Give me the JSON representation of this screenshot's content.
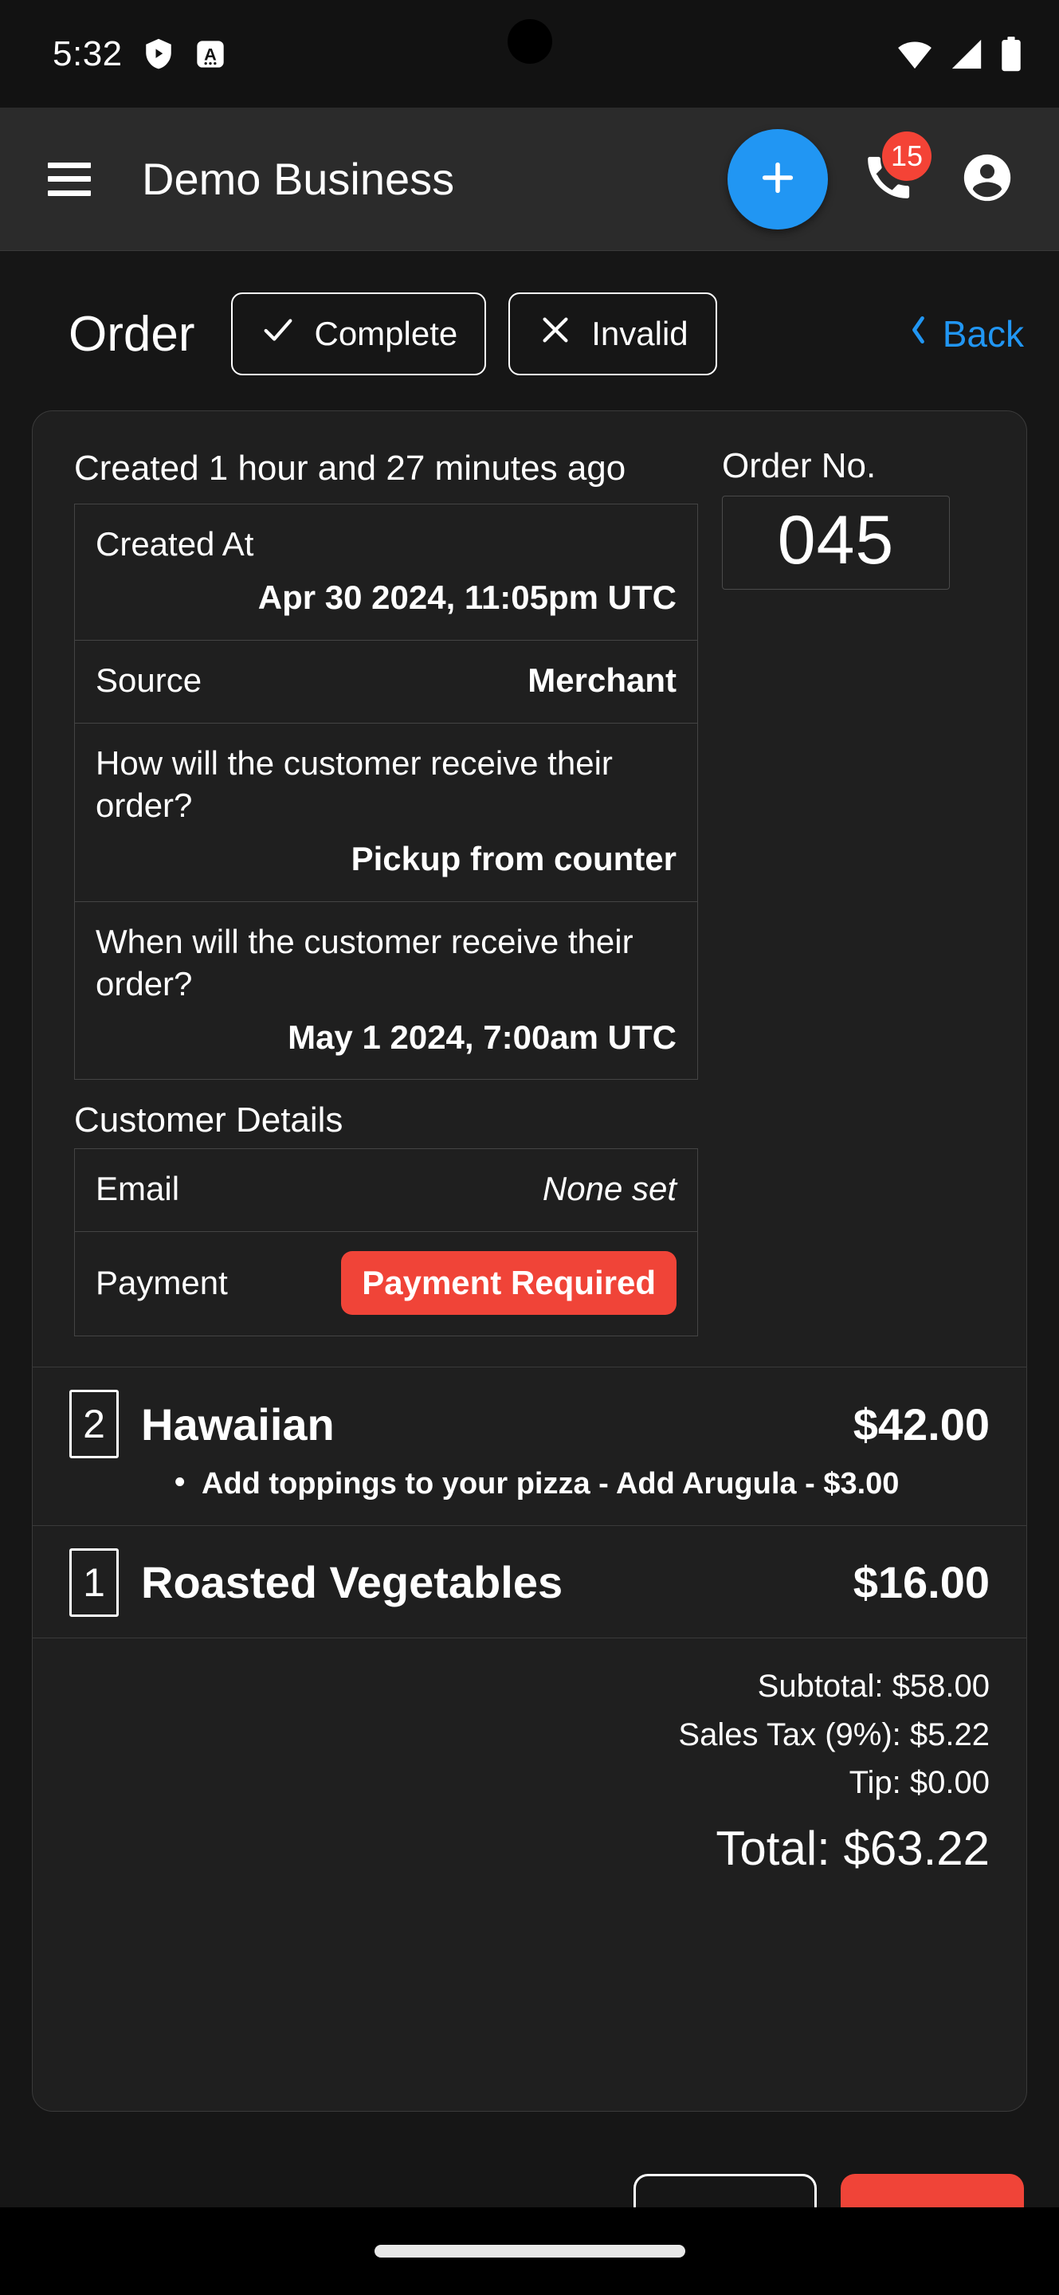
{
  "status_bar": {
    "time": "5:32",
    "left_icons": [
      "shield-play-icon",
      "a-notification-icon"
    ],
    "right_icons": [
      "wifi-icon",
      "cellular-signal-icon",
      "battery-icon"
    ]
  },
  "app_bar": {
    "menu_icon": "hamburger-menu-icon",
    "title": "Demo Business",
    "add_icon": "plus-icon",
    "phone_icon": "phone-icon",
    "call_badge_count": "15",
    "account_icon": "account-circle-icon",
    "accent_color": "#2196F3",
    "badge_color": "#F44336"
  },
  "page_header": {
    "title": "Order",
    "complete_label": "Complete",
    "complete_icon": "check-icon",
    "invalid_label": "Invalid",
    "invalid_icon": "close-x-icon",
    "back_label": "Back",
    "back_icon": "chevron-left-icon",
    "back_color": "#2196F3"
  },
  "order": {
    "created_ago": "Created 1 hour and 27 minutes ago",
    "order_no_label": "Order No.",
    "order_no_value": "045",
    "details": [
      {
        "label": "Created At",
        "value": "Apr 30 2024, 11:05pm UTC",
        "stacked": true
      },
      {
        "label": "Source",
        "value": "Merchant",
        "stacked": false
      },
      {
        "label": "How will the customer receive their order?",
        "value": "Pickup from counter",
        "stacked": true
      },
      {
        "label": "When will the customer receive their order?",
        "value": "May 1 2024, 7:00am UTC",
        "stacked": true
      }
    ],
    "customer_details_label": "Customer Details",
    "customer": [
      {
        "label": "Email",
        "value": "None set"
      }
    ],
    "payment_label": "Payment",
    "payment_status": "Payment Required",
    "payment_status_color": "#F04438"
  },
  "line_items": [
    {
      "qty": "2",
      "name": "Hawaiian",
      "price": "$42.00",
      "modifiers": [
        "Add toppings to your pizza - Add Arugula - $3.00"
      ]
    },
    {
      "qty": "1",
      "name": "Roasted Vegetables",
      "price": "$16.00",
      "modifiers": []
    }
  ],
  "totals": {
    "subtotal": "Subtotal: $58.00",
    "sales_tax": "Sales Tax (9%): $5.22",
    "tip": "Tip: $0.00",
    "total": "Total: $63.22"
  },
  "bottom_actions": {
    "secondary_label": "",
    "danger_label": ""
  }
}
